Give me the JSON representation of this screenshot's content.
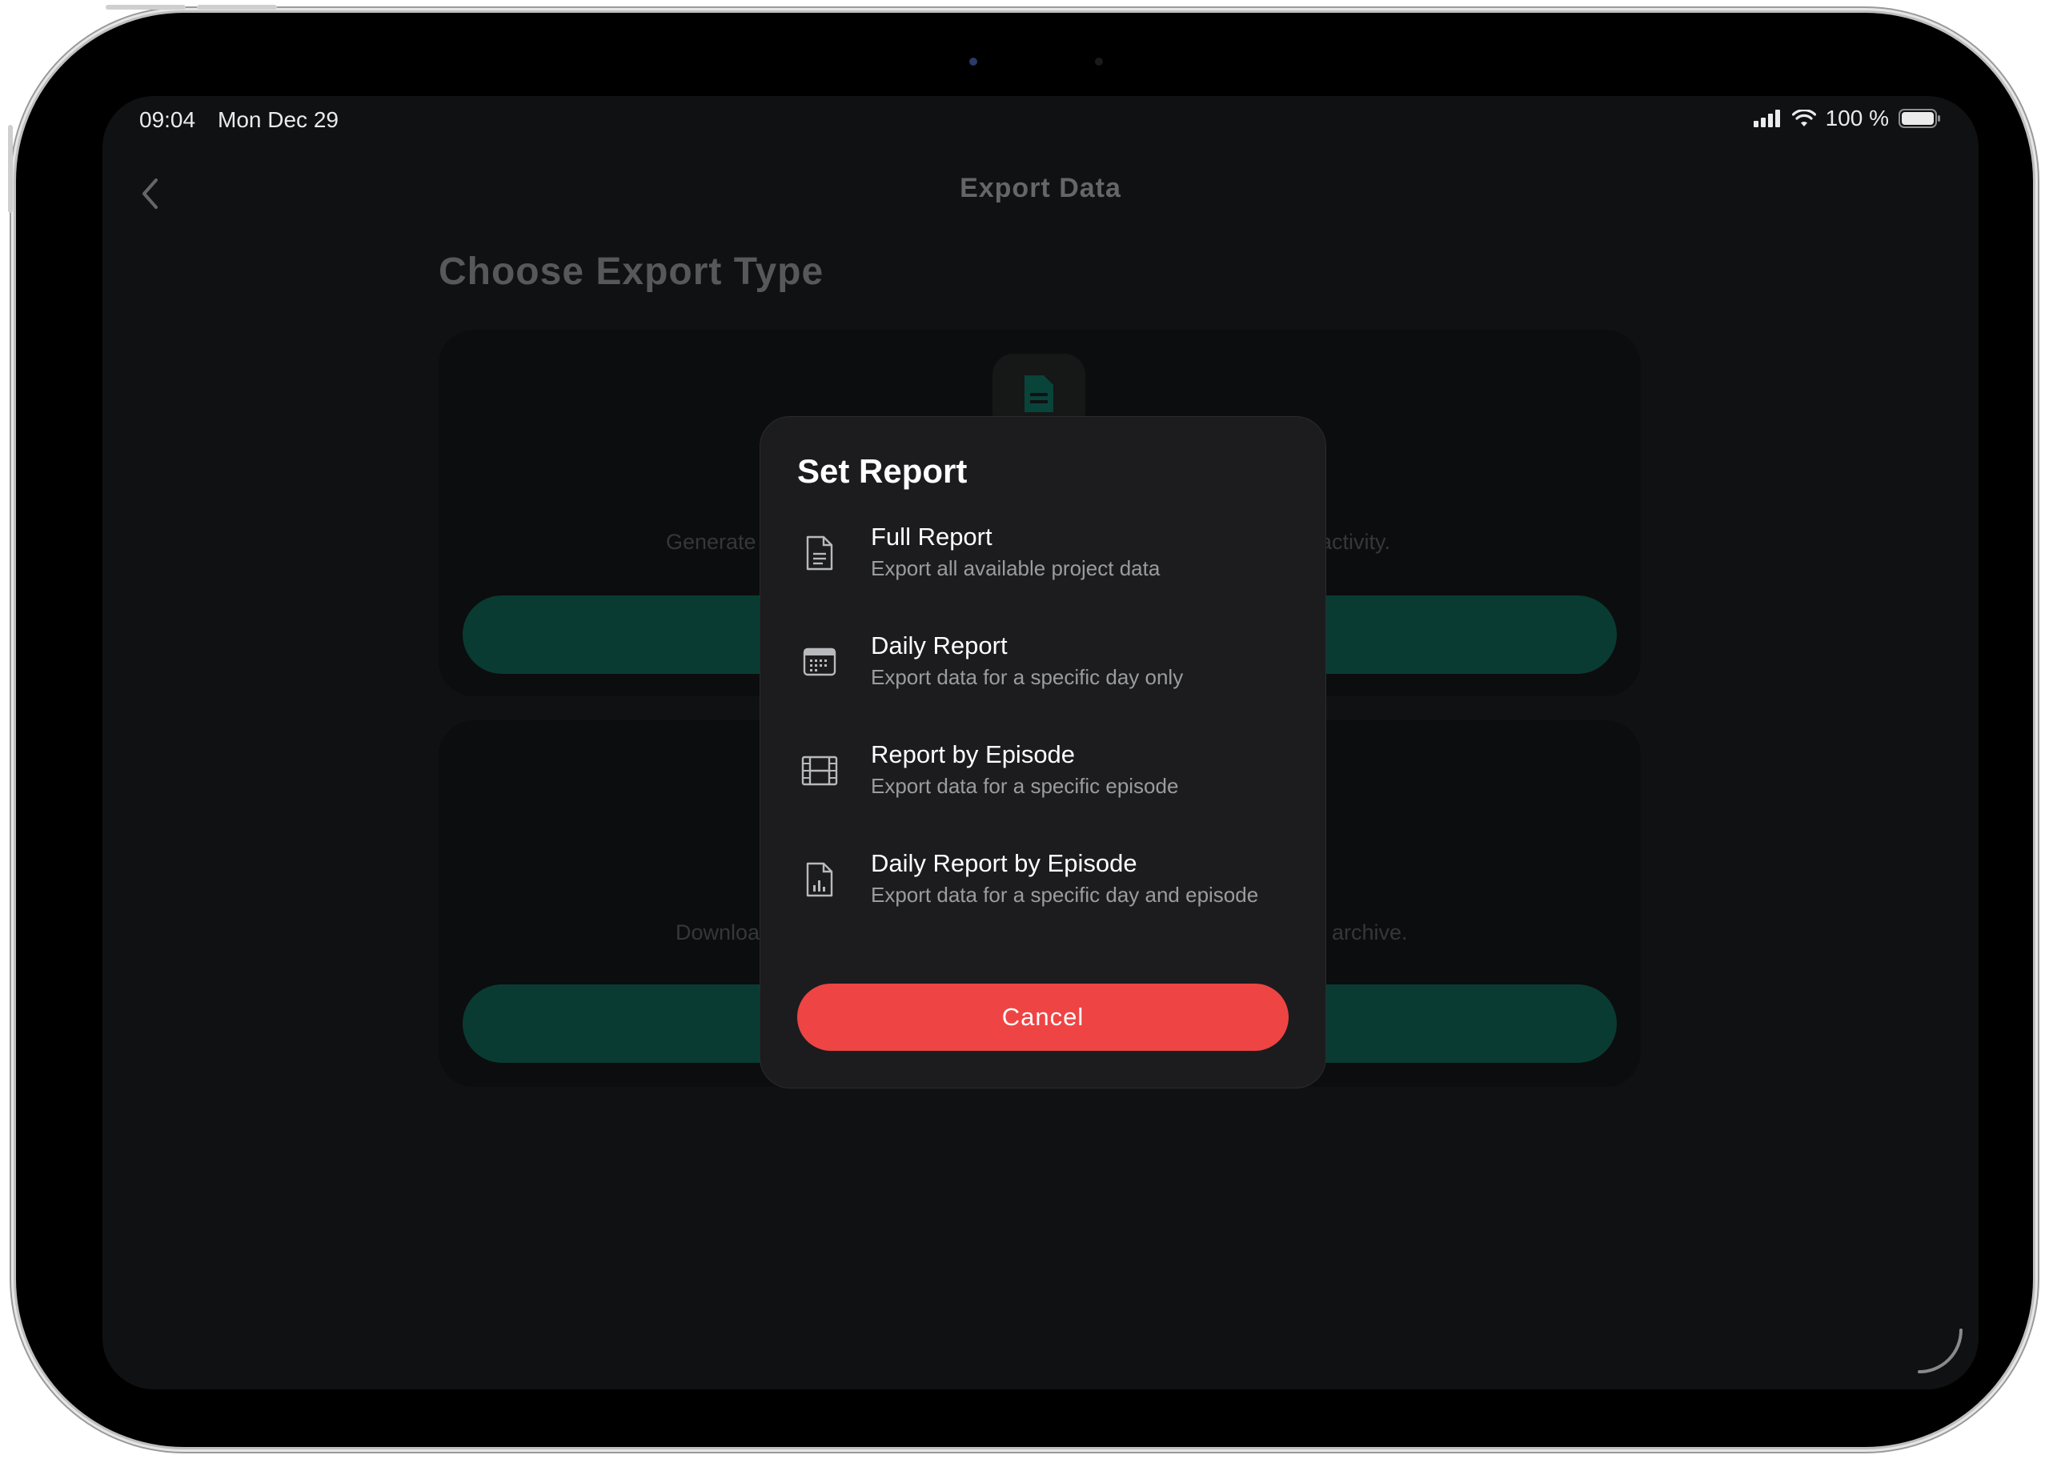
{
  "status_bar": {
    "time": "09:04",
    "date": "Mon Dec 29",
    "battery_percent": "100 %"
  },
  "nav": {
    "title": "Export Data"
  },
  "page": {
    "section_title": "Choose Export Type",
    "cards": [
      {
        "description_visible": "Generate",
        "description_visible_right": "t activity."
      },
      {
        "description_visible": "Downloa",
        "description_visible_right": "archive."
      }
    ]
  },
  "modal": {
    "title": "Set Report",
    "options": [
      {
        "label": "Full Report",
        "subtitle": "Export all available project data",
        "icon": "document-icon"
      },
      {
        "label": "Daily Report",
        "subtitle": "Export data for a specific day only",
        "icon": "calendar-icon"
      },
      {
        "label": "Report by Episode",
        "subtitle": "Export data for a specific episode",
        "icon": "film-icon"
      },
      {
        "label": "Daily Report by Episode",
        "subtitle": "Export data for a specific day and episode",
        "icon": "chart-document-icon"
      }
    ],
    "cancel_label": "Cancel"
  },
  "colors": {
    "accent_red": "#ef4444",
    "teal_button": "#0a4038",
    "background": "#121314",
    "modal_bg": "#1c1c1e"
  }
}
